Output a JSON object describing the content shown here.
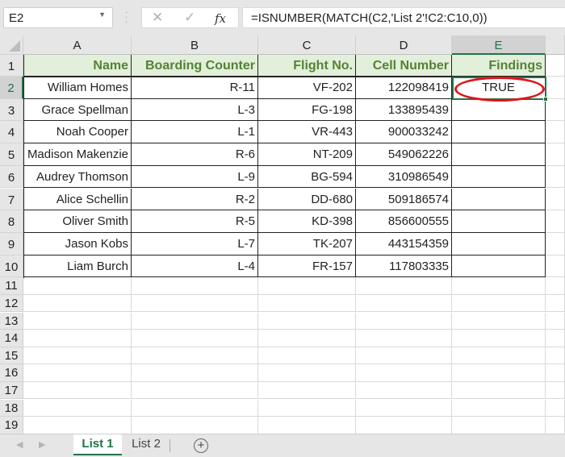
{
  "formula_bar": {
    "name_box": "E2",
    "cancel_icon": "✕",
    "enter_icon": "✓",
    "fx_icon": "fx",
    "formula": "=ISNUMBER(MATCH(C2,'List 2'!C2:C10,0))"
  },
  "columns": [
    "A",
    "B",
    "C",
    "D",
    "E"
  ],
  "selected_column": "E",
  "rows": [
    "1",
    "2",
    "3",
    "4",
    "5",
    "6",
    "7",
    "8",
    "9",
    "10",
    "11",
    "12",
    "13",
    "14",
    "15",
    "16",
    "17",
    "18",
    "19"
  ],
  "selected_row": "2",
  "table": {
    "headers": [
      "Name",
      "Boarding Counter",
      "Flight No.",
      "Cell Number",
      "Findings"
    ],
    "rows": [
      [
        "William Homes",
        "R-11",
        "VF-202",
        "122098419",
        "TRUE"
      ],
      [
        "Grace Spellman",
        "L-3",
        "FG-198",
        "133895439",
        ""
      ],
      [
        "Noah Cooper",
        "L-1",
        "VR-443",
        "900033242",
        ""
      ],
      [
        "Madison Makenzie",
        "R-6",
        "NT-209",
        "549062226",
        ""
      ],
      [
        "Audrey Thomson",
        "L-9",
        "BG-594",
        "310986549",
        ""
      ],
      [
        "Alice Schellin",
        "R-2",
        "DD-680",
        "509186574",
        ""
      ],
      [
        "Oliver Smith",
        "R-5",
        "KD-398",
        "856600555",
        ""
      ],
      [
        "Jason Kobs",
        "L-7",
        "TK-207",
        "443154359",
        ""
      ],
      [
        "Liam Burch",
        "L-4",
        "FR-157",
        "117803335",
        ""
      ]
    ]
  },
  "highlight_color": "#e0141b",
  "accent_color": "#217346",
  "header_fill": "#e2efda",
  "header_text_color": "#548235",
  "sheet_tabs": {
    "nav_prev": "◀",
    "nav_next": "▶",
    "tabs": [
      {
        "label": "List 1",
        "active": true
      },
      {
        "label": "List 2",
        "active": false
      }
    ],
    "add_sheet": "+"
  }
}
